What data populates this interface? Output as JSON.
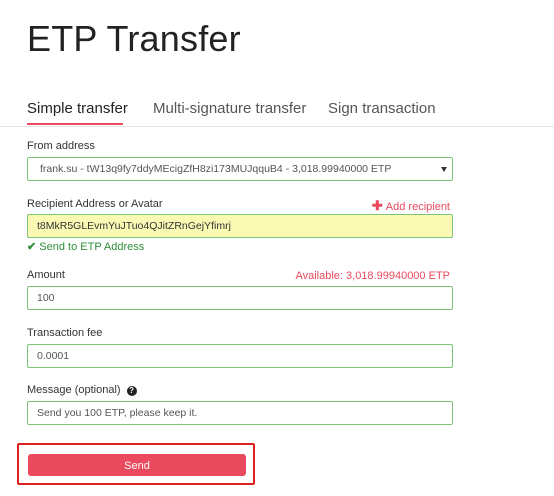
{
  "page": {
    "title": "ETP Transfer"
  },
  "tabs": [
    {
      "label": "Simple transfer",
      "active": true
    },
    {
      "label": "Multi-signature transfer",
      "active": false
    },
    {
      "label": "Sign transaction",
      "active": false
    }
  ],
  "form": {
    "from_address": {
      "label": "From address",
      "value": "frank.su - tW13q9fy7ddyMEcigZfH8zi173MUJqquB4 - 3,018.99940000 ETP"
    },
    "recipient": {
      "label": "Recipient Address or Avatar",
      "add_label": "Add recipient",
      "value": "t8MkR5GLEvmYuJTuo4QJitZRnGejYfimrj",
      "status": "Send to ETP Address"
    },
    "amount": {
      "label": "Amount",
      "available": "Available: 3,018.99940000 ETP",
      "value": "100"
    },
    "fee": {
      "label": "Transaction fee",
      "value": "0.0001"
    },
    "message": {
      "label": "Message (optional)",
      "value": "Send you 100 ETP, please keep it."
    },
    "send_label": "Send"
  },
  "colors": {
    "accent": "#e94a5d",
    "field_border": "#7cc576",
    "success": "#2f8f3a",
    "highlight": "#e02020",
    "recipient_bg": "#fafab4"
  },
  "icons": {
    "add": "plus-icon",
    "check": "check-icon",
    "help": "help-icon",
    "dropdown": "chevron-down-icon"
  }
}
